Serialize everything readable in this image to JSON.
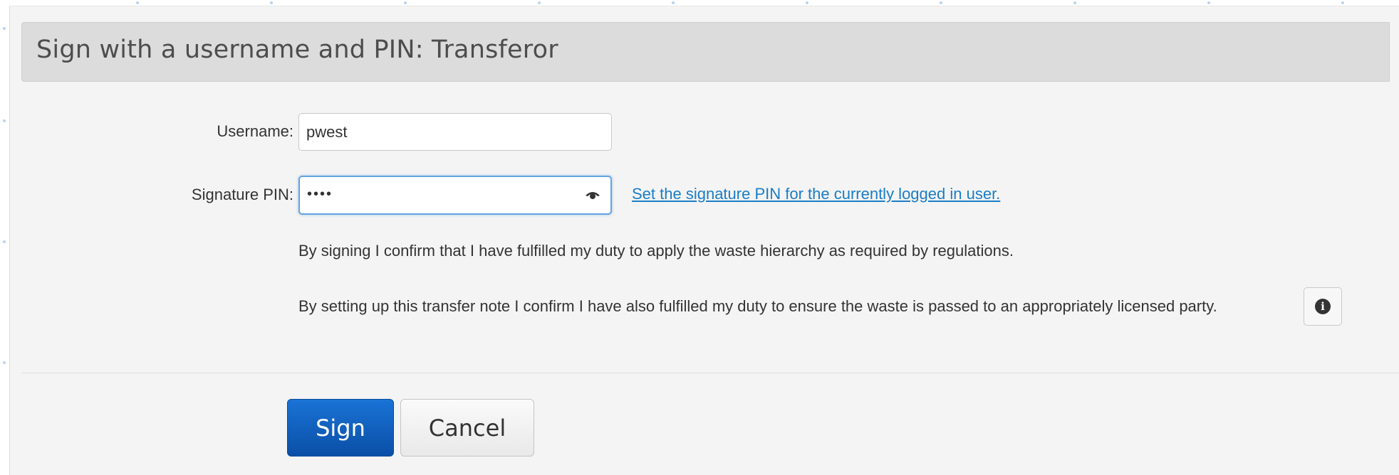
{
  "dialog": {
    "title": "Sign with a username and PIN: Transferor"
  },
  "form": {
    "username_label": "Username:",
    "username_value": "pwest",
    "pin_label": "Signature PIN:",
    "pin_masked": "••••",
    "set_pin_link": "Set the signature PIN for the currently logged in user.",
    "statement_hierarchy": "By signing I confirm that I have fulfilled my duty to apply the waste hierarchy as required by regulations.",
    "statement_transfer": "By setting up this transfer note I confirm I have also fulfilled my duty to ensure the waste is passed to an appropriately licensed party."
  },
  "buttons": {
    "sign_label": "Sign",
    "cancel_label": "Cancel"
  },
  "icons": {
    "eye": "eye-icon",
    "info": "info-icon"
  },
  "colors": {
    "primary": "#0a5cc0",
    "link": "#1a7dc6",
    "header_bg": "#dcdcdc",
    "focus": "#66a3e0"
  }
}
